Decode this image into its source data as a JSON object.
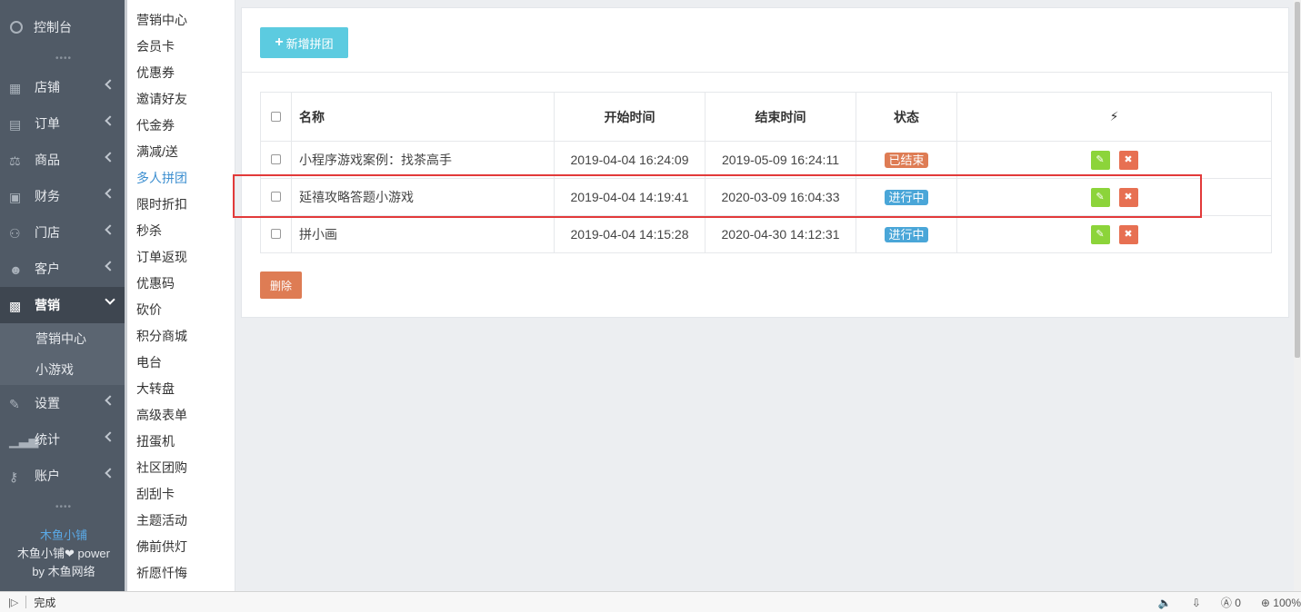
{
  "sidebar": {
    "dashboard": "控制台",
    "items": [
      {
        "label": "店铺",
        "icon": "shop-icon"
      },
      {
        "label": "订单",
        "icon": "order-icon"
      },
      {
        "label": "商品",
        "icon": "scale-icon"
      },
      {
        "label": "财务",
        "icon": "money-icon"
      },
      {
        "label": "门店",
        "icon": "sitemap-icon"
      },
      {
        "label": "客户",
        "icon": "users-icon"
      },
      {
        "label": "营销",
        "icon": "gift-icon",
        "active": true
      },
      {
        "label": "设置",
        "icon": "wrench-icon"
      },
      {
        "label": "统计",
        "icon": "signal-icon"
      },
      {
        "label": "账户",
        "icon": "key-icon"
      }
    ],
    "sub_items": [
      "营销中心",
      "小游戏"
    ],
    "brand": {
      "name": "木鱼小铺",
      "line2": "木鱼小铺❤ power",
      "line3": "by 木鱼网络"
    }
  },
  "subnav": [
    "营销中心",
    "会员卡",
    "优惠券",
    "邀请好友",
    "代金券",
    "满减/送",
    "多人拼团",
    "限时折扣",
    "秒杀",
    "订单返现",
    "优惠码",
    "砍价",
    "积分商城",
    "电台",
    "大转盘",
    "高级表单",
    "扭蛋机",
    "社区团购",
    "刮刮卡",
    "主题活动",
    "佛前供灯",
    "祈愿忏悔"
  ],
  "subnav_active": "多人拼团",
  "toolbar": {
    "add_label": "新增拼团",
    "delete_label": "删除"
  },
  "table": {
    "headers": {
      "name": "名称",
      "start": "开始时间",
      "end": "结束时间",
      "status": "状态",
      "actions": "⚡"
    },
    "rows": [
      {
        "name": "小程序游戏案例：找茶高手",
        "start": "2019-04-04 16:24:09",
        "end": "2019-05-09 16:24:11",
        "status": "已结束",
        "status_color": "#de7c54"
      },
      {
        "name": "延禧攻略答题小游戏",
        "start": "2019-04-04 14:19:41",
        "end": "2020-03-09 16:04:33",
        "status": "进行中",
        "status_color": "#4aa6d8"
      },
      {
        "name": "拼小画",
        "start": "2019-04-04 14:15:28",
        "end": "2020-04-30 14:12:31",
        "status": "进行中",
        "status_color": "#4aa6d8"
      }
    ]
  },
  "statusbar": {
    "text": "完成",
    "counter": "0",
    "zoom": "100%"
  }
}
